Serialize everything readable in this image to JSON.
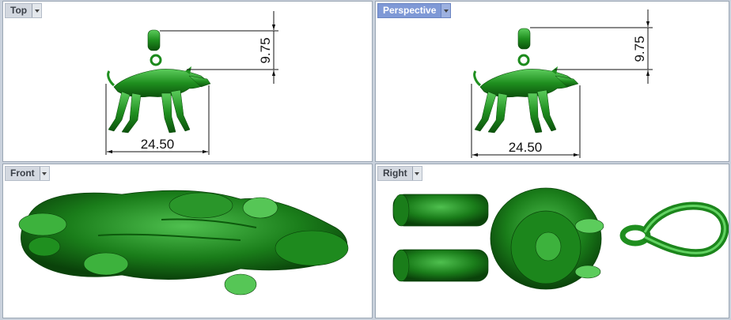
{
  "viewports": {
    "top": {
      "label": "Top",
      "dim_width": "24.50",
      "dim_height": "9.75"
    },
    "perspective": {
      "label": "Perspective",
      "dim_width": "24.50",
      "dim_height": "9.75"
    },
    "front": {
      "label": "Front"
    },
    "right": {
      "label": "Right"
    }
  },
  "colors": {
    "model": "#1f8f1f",
    "model_dark": "#0a4a0a",
    "model_light": "#63d063",
    "active_tab": "#7f99d6",
    "background": "#c9d1dc"
  }
}
